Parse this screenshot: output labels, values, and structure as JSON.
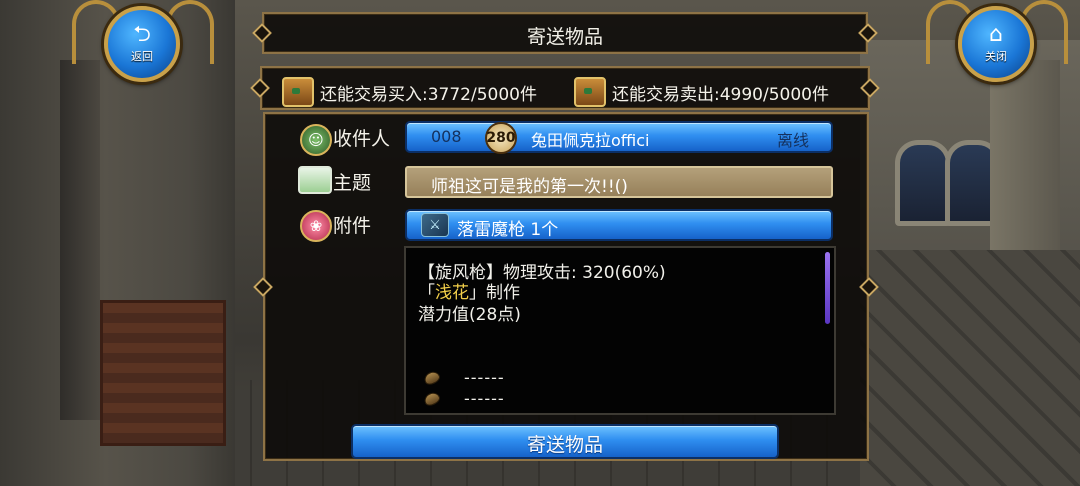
{
  "nav": {
    "back_label": "返回",
    "close_label": "关闭"
  },
  "dialog": {
    "title": "寄送物品"
  },
  "quota": {
    "buy_label": "还能交易买入:",
    "buy_value": "3772/5000件",
    "sell_label": "还能交易卖出:",
    "sell_value": "4990/5000件"
  },
  "form": {
    "recipient_label": "收件人",
    "recipient_id": "008",
    "recipient_level": "280",
    "recipient_name": "兔田佩克拉offici",
    "recipient_status": "离线",
    "subject_label": "主题",
    "subject_text": "师祖这可是我的第一次!!()",
    "attachment_label": "附件",
    "attachment_item": "落雷魔枪 1个"
  },
  "item_details": {
    "line1": "【旋风枪】物理攻击: 320(60%)",
    "maker_open": "「",
    "maker_name": "浅花",
    "maker_close": "」制作",
    "line3": "潜力值(28点)",
    "gem_slots": [
      "------",
      "------"
    ]
  },
  "actions": {
    "send_label": "寄送物品"
  },
  "colors": {
    "accent_blue": "#2f8ef0",
    "frame_gold": "#8e7346",
    "maker_gold": "#f2cf4a",
    "scrollbar_purple": "#7a55e0"
  }
}
